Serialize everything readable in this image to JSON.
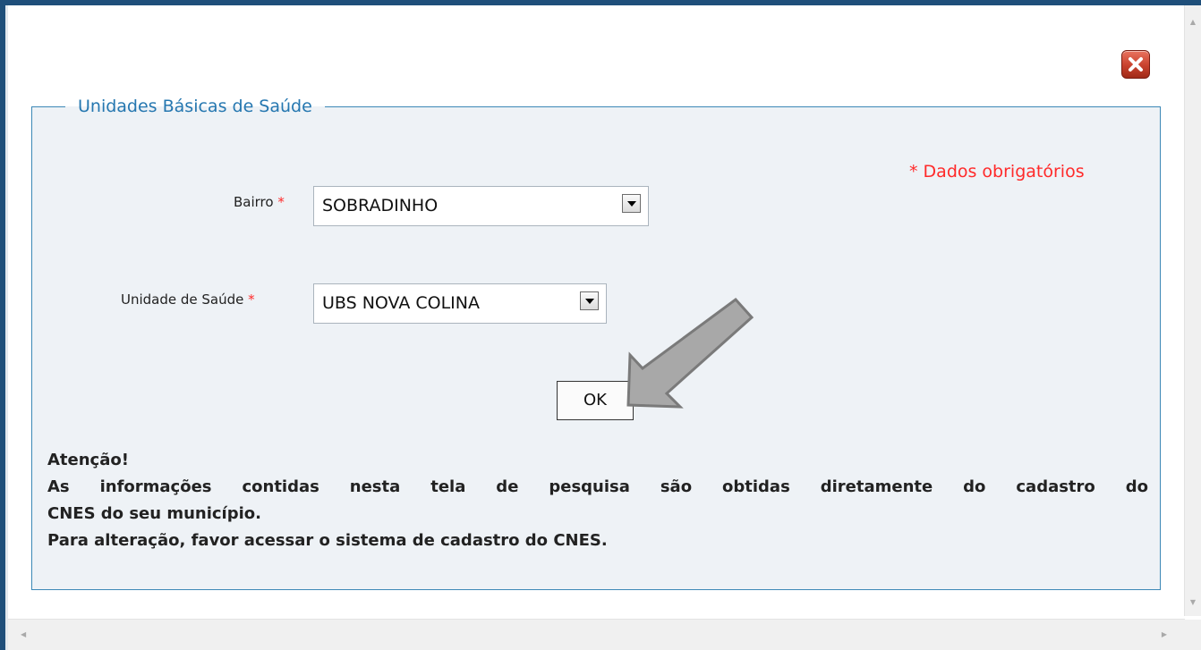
{
  "dialog": {
    "close_icon": "close-x-icon",
    "close_color": "#c8412d"
  },
  "panel": {
    "legend": "Unidades Básicas de Saúde",
    "required_note": "* Dados obrigatórios",
    "accent_color": "#3c88b6"
  },
  "form": {
    "bairro": {
      "label": "Bairro",
      "required_mark": "*",
      "value": "SOBRADINHO"
    },
    "unidade": {
      "label": "Unidade de Saúde",
      "required_mark": "*",
      "value": "UBS NOVA COLINA"
    },
    "ok_label": "OK"
  },
  "attention": {
    "title": "Atenção!",
    "line1": "As informações contidas nesta tela de pesquisa são obtidas diretamente do cadastro do",
    "line2": "CNES do seu município.",
    "line3": "Para alteração, favor acessar o sistema de cadastro do CNES."
  },
  "scrollbars": {
    "up_icon": "scroll-up-arrow-icon",
    "down_icon": "scroll-down-arrow-icon",
    "left_icon": "scroll-left-arrow-icon",
    "right_icon": "scroll-right-arrow-icon"
  }
}
